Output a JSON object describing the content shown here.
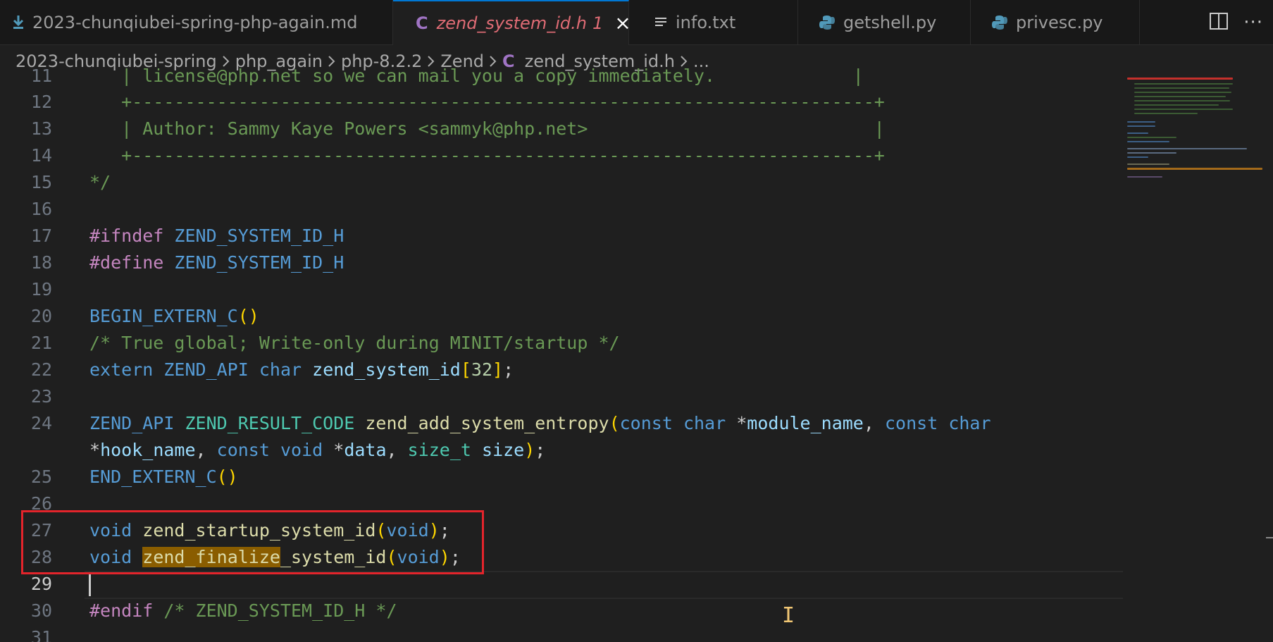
{
  "tabs": [
    {
      "label": "2023-chunqiubei-spring-php-again.md",
      "icon": "markdown-download-icon"
    },
    {
      "label": "zend_system_id.h",
      "badge": "1",
      "icon": "c-file-icon",
      "active": true
    },
    {
      "label": "info.txt",
      "icon": "text-lines-icon"
    },
    {
      "label": "getshell.py",
      "icon": "python-icon"
    },
    {
      "label": "privesc.py",
      "icon": "python-icon"
    }
  ],
  "breadcrumb": {
    "items": [
      "2023-chunqiubei-spring",
      "php_again",
      "php-8.2.2",
      "Zend",
      "zend_system_id.h",
      "..."
    ],
    "file_icon_letter": "C"
  },
  "editor": {
    "line_numbers": [
      "11",
      "12",
      "13",
      "14",
      "15",
      "16",
      "17",
      "18",
      "19",
      "20",
      "21",
      "22",
      "23",
      "24",
      "",
      "25",
      "26",
      "27",
      "28",
      "29",
      "30",
      "31"
    ],
    "lines": [
      "   | license@php.net so we can mail you a copy immediately.             |",
      "   +----------------------------------------------------------------------+",
      "   | Author: Sammy Kaye Powers <sammyk@php.net>                           |",
      "   +----------------------------------------------------------------------+",
      "*/",
      "",
      "#ifndef ZEND_SYSTEM_ID_H",
      "#define ZEND_SYSTEM_ID_H",
      "",
      "BEGIN_EXTERN_C()",
      "/* True global; Write-only during MINIT/startup */",
      "extern ZEND_API char zend_system_id[32];",
      "",
      "ZEND_API ZEND_RESULT_CODE zend_add_system_entropy(const char *module_name, const char",
      "*hook_name, const void *data, size_t size);",
      "END_EXTERN_C()",
      "",
      "void zend_startup_system_id(void);",
      "void zend_finalize_system_id(void);",
      "",
      "#endif /* ZEND_SYSTEM_ID_H */",
      ""
    ],
    "tokens": {
      "ifndef": "#ifndef",
      "define": "#define",
      "guard": "ZEND_SYSTEM_ID_H",
      "begin_extern": "BEGIN_EXTERN_C",
      "end_extern": "END_EXTERN_C",
      "comment_global": "/* True global; Write-only during MINIT/startup */",
      "extern": "extern",
      "zend_api": "ZEND_API",
      "char": "char",
      "system_id_var": "zend_system_id",
      "num32": "32",
      "result_code": "ZEND_RESULT_CODE",
      "add_entropy": "zend_add_system_entropy",
      "const": "const",
      "module_name": "module_name",
      "hook_name": "hook_name",
      "void": "void",
      "data": "data",
      "size_t": "size_t",
      "size": "size",
      "startup": "zend_startup_system_id",
      "finalize_match": "zend_finalize",
      "finalize_rest": "_system_id",
      "endif": "#endif",
      "endif_comment": "/* ZEND_SYSTEM_ID_H */",
      "license_line": "   | license@php.net so we can mail you a copy immediately.             |",
      "rule_line": "   +----------------------------------------------------------------------+",
      "author_line": "   | Author: Sammy Kaye Powers <sammyk@php.net>                           |",
      "comment_end": "*/"
    }
  },
  "colors": {
    "background": "#1f1f1f",
    "highlight_box": "#e3242b",
    "search_match": "#8a5d00",
    "active_tab_text": "#e06c75"
  }
}
